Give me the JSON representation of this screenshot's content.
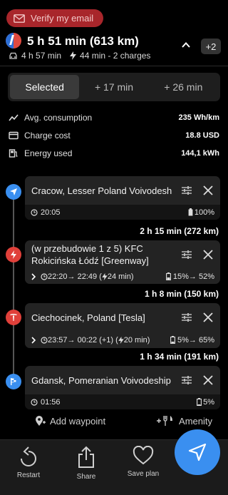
{
  "verify": {
    "label": "Verify my email",
    "icon": "mail-icon"
  },
  "summary": {
    "title": "5 h 51 min (613 km)",
    "drive_time": "4 h 57 min",
    "charge_info": "44 min - 2 charges",
    "more_count": "+2"
  },
  "tabs": [
    {
      "label": "Selected",
      "selected": true
    },
    {
      "label": "+ 17 min",
      "selected": false
    },
    {
      "label": "+ 26 min",
      "selected": false
    }
  ],
  "stats": [
    {
      "label": "Avg. consumption",
      "value": "235 Wh/km",
      "icon": "trend-icon"
    },
    {
      "label": "Charge cost",
      "value": "18.8 USD",
      "icon": "card-icon"
    },
    {
      "label": "Energy used",
      "value": "144,1 kWh",
      "icon": "fuel-icon"
    }
  ],
  "waypoints": [
    {
      "name": "Cracow, Lesser Poland Voivodeship",
      "time": "20:05",
      "battery": "100%",
      "node_color": "#3a8ff0"
    },
    {
      "name": "(w przebudowie 1 z 5) KFC Rokicińska Łódź [Greenway]",
      "time": "22:20→ 22:49 (",
      "charge_time": "24 min)",
      "battery": "15%→ 52%",
      "node_color": "#e0403a"
    },
    {
      "name": "Ciechocinek, Poland [Tesla]",
      "time": "23:57→ 00:22 (+1) (",
      "charge_time": "20 min)",
      "battery": "5%→ 65%",
      "node_color": "#e0403a"
    },
    {
      "name": "Gdansk, Pomeranian Voivodeship",
      "time": "01:56",
      "battery": "5%",
      "node_color": "#3a8ff0"
    }
  ],
  "legs": [
    {
      "distance": "2 h 15 min (272 km)"
    },
    {
      "distance": "1 h 8 min (150 km)"
    },
    {
      "distance": "1 h 34 min (191 km)"
    }
  ],
  "actions": {
    "add_waypoint": "Add waypoint",
    "amenity": "Amenity"
  },
  "bottom": {
    "restart": "Restart",
    "share": "Share",
    "save_plan": "Save plan"
  },
  "colors": {
    "accent": "#3a8ff0",
    "danger": "#a8262b"
  }
}
